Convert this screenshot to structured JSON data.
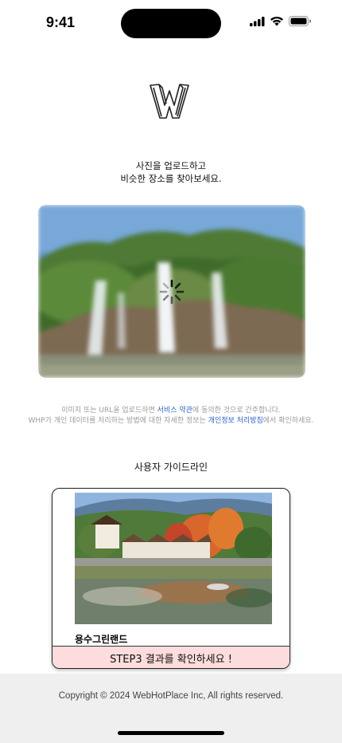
{
  "status_bar": {
    "time": "9:41",
    "icons": [
      "cellular-signal-icon",
      "wifi-icon",
      "battery-icon"
    ]
  },
  "logo": {
    "icon": "whp-logo-icon"
  },
  "headline": {
    "line1": "사진을 업로드하고",
    "line2": "비슷한 장소를 찾아보세요."
  },
  "upload": {
    "state": "loading",
    "spinner_icon": "loading-spinner-icon"
  },
  "disclaimer": {
    "line1_prefix": "이미지 또는 URL을 업로드하면 ",
    "terms_link": "서비스 약관",
    "line1_suffix": "에 동의한 것으로 간주합니다.",
    "line2_prefix": "WHP가 개인 데이터를 처리하는 방법에 대한 자세한 정보는 ",
    "privacy_link": "개인정보 처리방침",
    "line2_suffix": "에서 확인하세요."
  },
  "guide": {
    "title": "사용자 가이드라인",
    "place_name": "용수그린랜드",
    "cta_label": "STEP3 결과를 확인하세요 !"
  },
  "footer": {
    "copyright": "Copyright © 2024 WebHotPlace Inc, All rights reserved."
  },
  "colors": {
    "link": "#2b62d6",
    "cta_background": "#fcdcdc",
    "footer_background": "#efefef"
  }
}
